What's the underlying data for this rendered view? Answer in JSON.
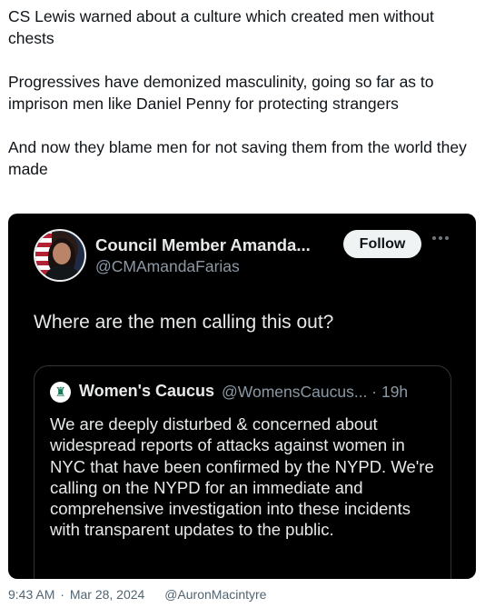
{
  "tweet": {
    "paragraphs": [
      "CS Lewis warned about a culture which created men without chests",
      "Progressives have demonized masculinity, going so far as to imprison men like Daniel Penny for protecting strangers",
      "And now they blame men for not saving them from the world they made"
    ]
  },
  "embedded_tweet": {
    "author_name": "Council Member Amanda...",
    "author_handle": "@CMAmandaFarias",
    "follow_label": "Follow",
    "more_icon": "more-horizontal-icon",
    "text": "Where are the men calling this out?",
    "quoted_tweet": {
      "author_name": "Women's Caucus",
      "author_handle_time": "@WomensCaucus... · 19h",
      "logo_icon": "statue-of-liberty-icon",
      "text": "We are deeply disturbed & concerned about widespread reports of attacks against women in NYC that have been confirmed by the NYPD. We're calling on the NYPD for an immediate and comprehensive investigation into these incidents with transparent updates to the public."
    }
  },
  "footer": {
    "time": "9:43 AM",
    "separator": "·",
    "date": "Mar 28, 2024",
    "author": "@AuronMacintyre"
  },
  "colors": {
    "embed_background": "#000000",
    "embed_text": "#e7e9ea",
    "secondary_text": "#8b98a5",
    "follow_button_bg": "#eff3f4",
    "footer_text": "#536471"
  }
}
